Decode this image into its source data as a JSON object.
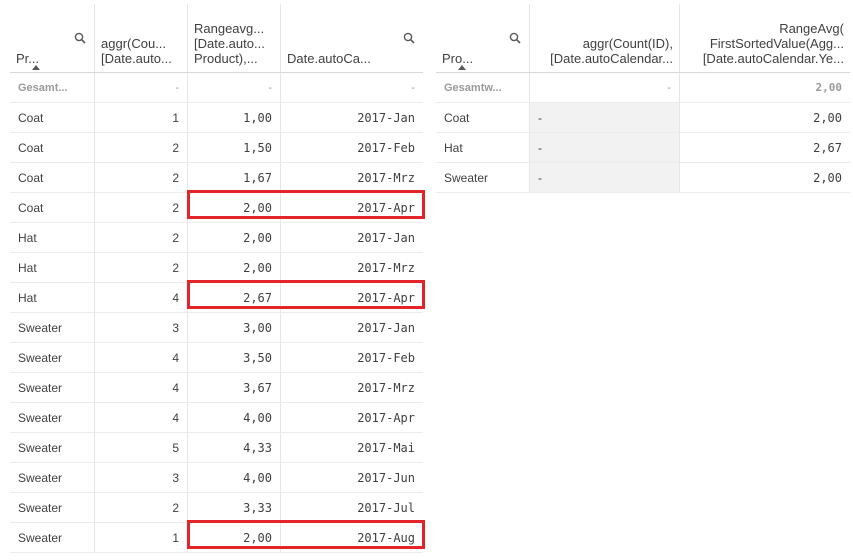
{
  "table1": {
    "headers": [
      {
        "label": "Pr...",
        "search": true,
        "sorted": true
      },
      {
        "label": "aggr(Cou...\n[Date.auto..."
      },
      {
        "label": "Rangeavg...\n[Date.auto...\nProduct),..."
      },
      {
        "label": "Date.autoCa...",
        "search": true
      }
    ],
    "total": [
      "Gesamt...",
      "-",
      "-",
      "-"
    ],
    "rows": [
      [
        "Coat",
        "1",
        "1,00",
        "2017-Jan"
      ],
      [
        "Coat",
        "2",
        "1,50",
        "2017-Feb"
      ],
      [
        "Coat",
        "2",
        "1,67",
        "2017-Mrz"
      ],
      [
        "Coat",
        "2",
        "2,00",
        "2017-Apr"
      ],
      [
        "Hat",
        "2",
        "2,00",
        "2017-Jan"
      ],
      [
        "Hat",
        "2",
        "2,00",
        "2017-Mrz"
      ],
      [
        "Hat",
        "4",
        "2,67",
        "2017-Apr"
      ],
      [
        "Sweater",
        "3",
        "3,00",
        "2017-Jan"
      ],
      [
        "Sweater",
        "4",
        "3,50",
        "2017-Feb"
      ],
      [
        "Sweater",
        "4",
        "3,67",
        "2017-Mrz"
      ],
      [
        "Sweater",
        "4",
        "4,00",
        "2017-Apr"
      ],
      [
        "Sweater",
        "5",
        "4,33",
        "2017-Mai"
      ],
      [
        "Sweater",
        "3",
        "4,00",
        "2017-Jun"
      ],
      [
        "Sweater",
        "2",
        "3,33",
        "2017-Jul"
      ],
      [
        "Sweater",
        "1",
        "2,00",
        "2017-Aug"
      ]
    ],
    "highlighted_rows": [
      3,
      6,
      14
    ]
  },
  "table2": {
    "headers": [
      {
        "label": "Pro...",
        "search": true,
        "sorted": true
      },
      {
        "label": "aggr(Count(ID),\n[Date.autoCalendar..."
      },
      {
        "label": "RangeAvg(\nFirstSortedValue(Agg...\n[Date.autoCalendar.Ye..."
      }
    ],
    "total": [
      "Gesamtw...",
      "-",
      "2,00"
    ],
    "rows": [
      [
        "Coat",
        "-",
        "2,00"
      ],
      [
        "Hat",
        "-",
        "2,67"
      ],
      [
        "Sweater",
        "-",
        "2,00"
      ]
    ]
  },
  "colors": {
    "highlight": "#e3242b",
    "grid": "#e6e6e6",
    "null_cell": "#f2f2f2"
  },
  "icons": [
    "search-icon",
    "sort-ascending-icon"
  ]
}
